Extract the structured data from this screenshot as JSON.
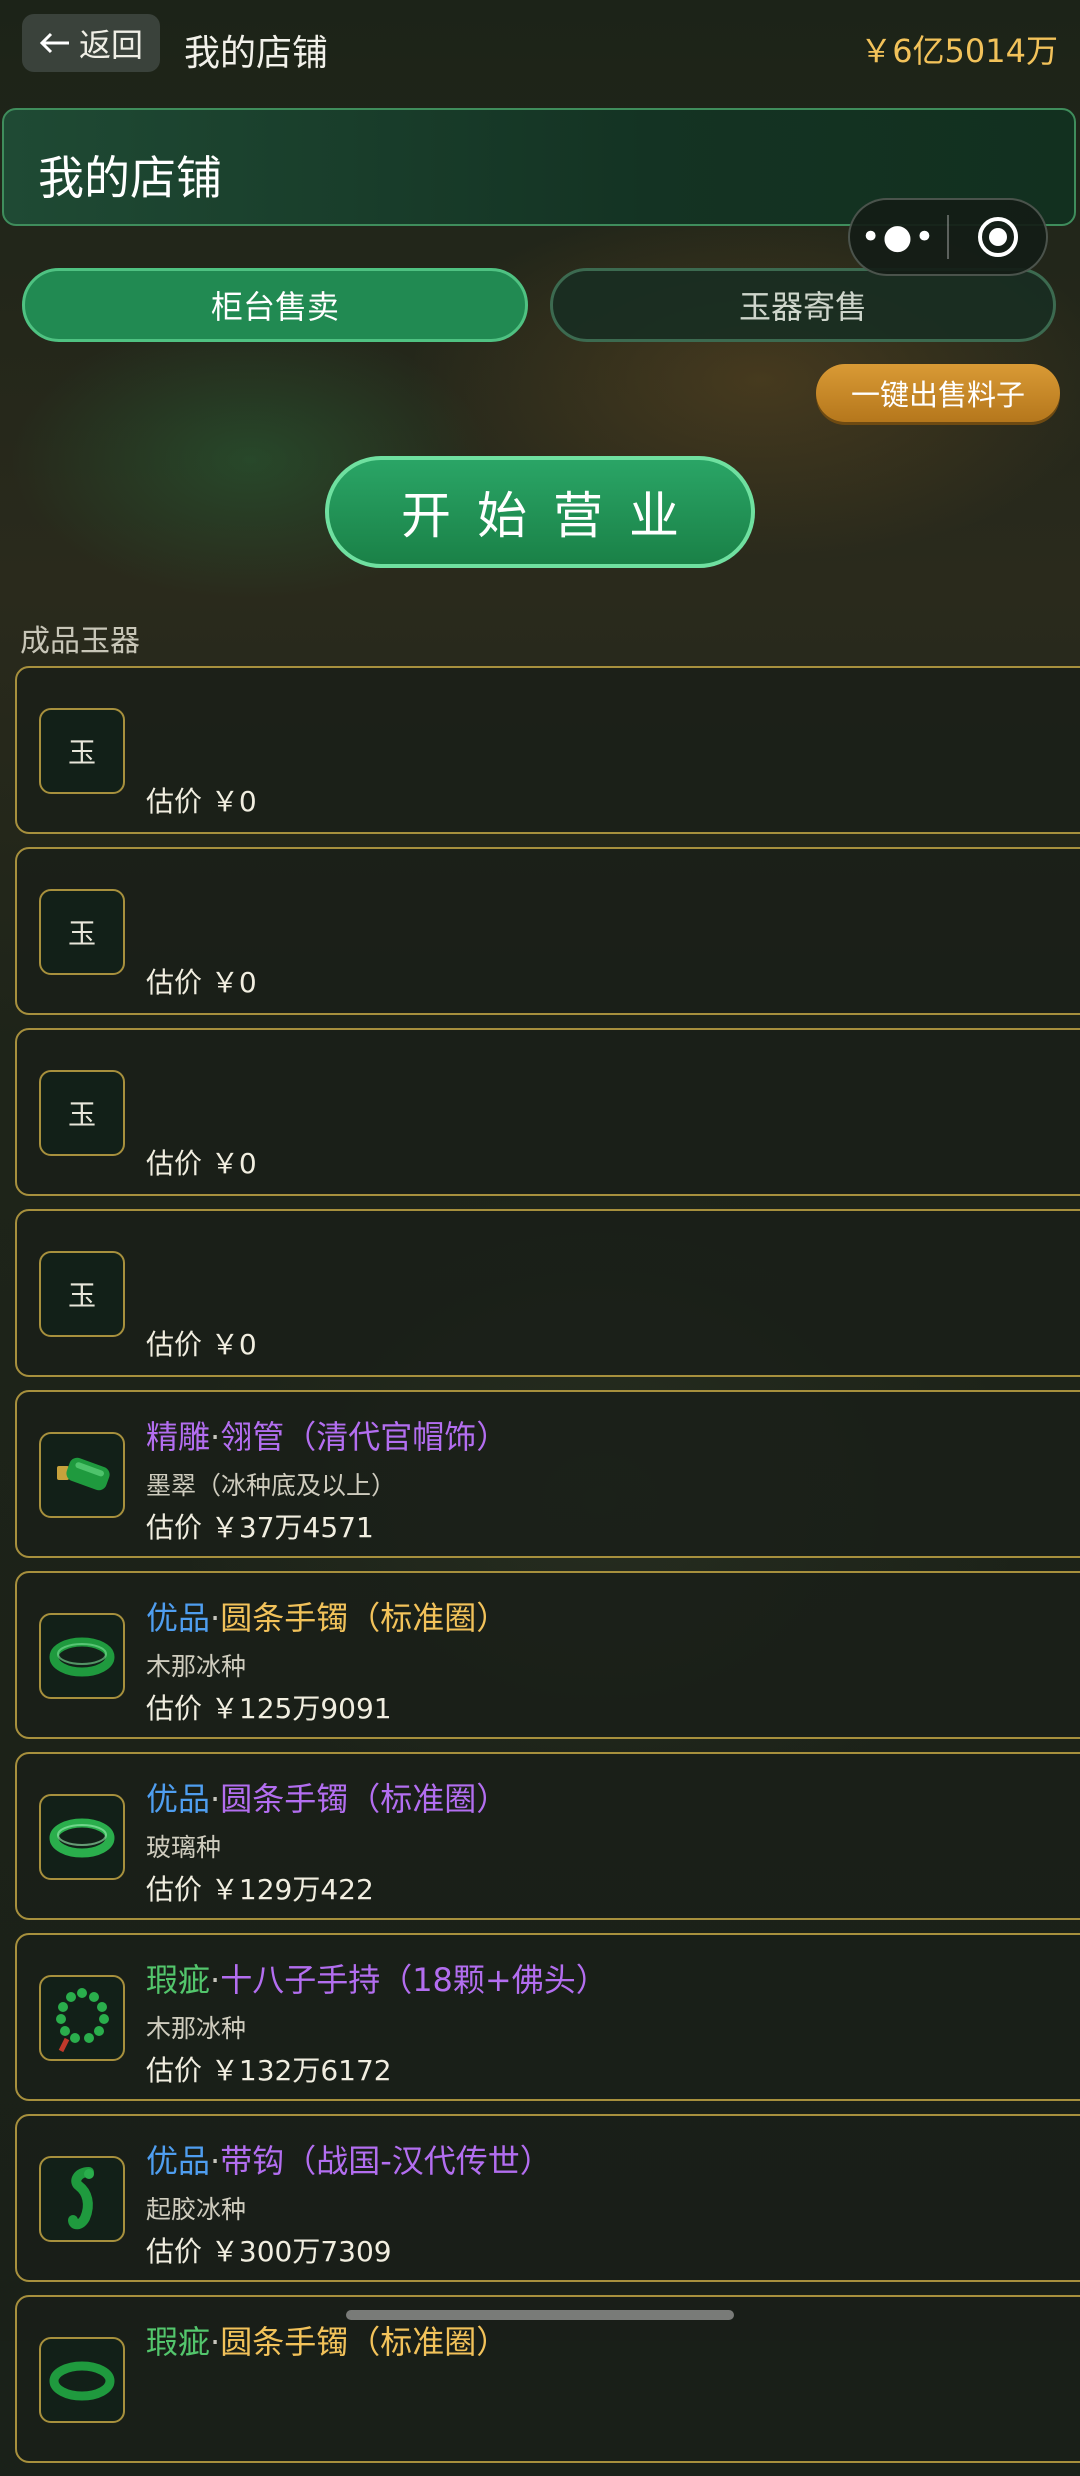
{
  "header": {
    "back_label": "返回",
    "title": "我的店铺",
    "balance": "￥6亿5014万"
  },
  "title_bar": {
    "text": "我的店铺"
  },
  "capsule": {
    "menu_icon": "more-dots-icon",
    "close_icon": "target-circle-icon"
  },
  "tabs": [
    {
      "label": "柜台售卖",
      "active": true
    },
    {
      "label": "玉器寄售",
      "active": false
    }
  ],
  "sell_materials_label": "一键出售料子",
  "start_business_label": "开始营业",
  "section_label": "成品玉器",
  "colors": {
    "accent_green": "#218a52",
    "gold_border": "#a7903d",
    "gold_text": "#f2c25a",
    "purple_grade": "#b36ef0",
    "blue_grade": "#4f9ef0",
    "green_grade": "#53c66c"
  },
  "items": [
    {
      "placeholder_glyph": "玉",
      "price_label": "估价",
      "price": "￥0"
    },
    {
      "placeholder_glyph": "玉",
      "price_label": "估价",
      "price": "￥0"
    },
    {
      "placeholder_glyph": "玉",
      "price_label": "估价",
      "price": "￥0"
    },
    {
      "placeholder_glyph": "玉",
      "price_label": "估价",
      "price": "￥0"
    },
    {
      "icon": "jade-tube-icon",
      "grade": "精雕",
      "separator": "·",
      "title": "翎管（清代官帽饰）",
      "material": "墨翠（冰种底及以上）",
      "price_label": "估价",
      "price": "￥37万4571"
    },
    {
      "icon": "jade-bangle-icon",
      "grade": "优品",
      "separator": "·",
      "title": "圆条手镯（标准圈）",
      "material": "木那冰种",
      "price_label": "估价",
      "price": "￥125万9091"
    },
    {
      "icon": "jade-bangle-icon",
      "grade": "优品",
      "separator": "·",
      "title": "圆条手镯（标准圈）",
      "material": "玻璃种",
      "price_label": "估价",
      "price": "￥129万422"
    },
    {
      "icon": "jade-beads-icon",
      "grade": "瑕疵",
      "separator": "·",
      "title": "十八子手持（18颗+佛头）",
      "material": "木那冰种",
      "price_label": "估价",
      "price": "￥132万6172"
    },
    {
      "icon": "jade-hook-icon",
      "grade": "优品",
      "separator": "·",
      "title": "带钩（战国-汉代传世）",
      "material": "起胶冰种",
      "price_label": "估价",
      "price": "￥300万7309"
    },
    {
      "icon": "jade-bangle-icon",
      "grade": "瑕疵",
      "separator": "·",
      "title": "圆条手镯（标准圈）"
    }
  ]
}
